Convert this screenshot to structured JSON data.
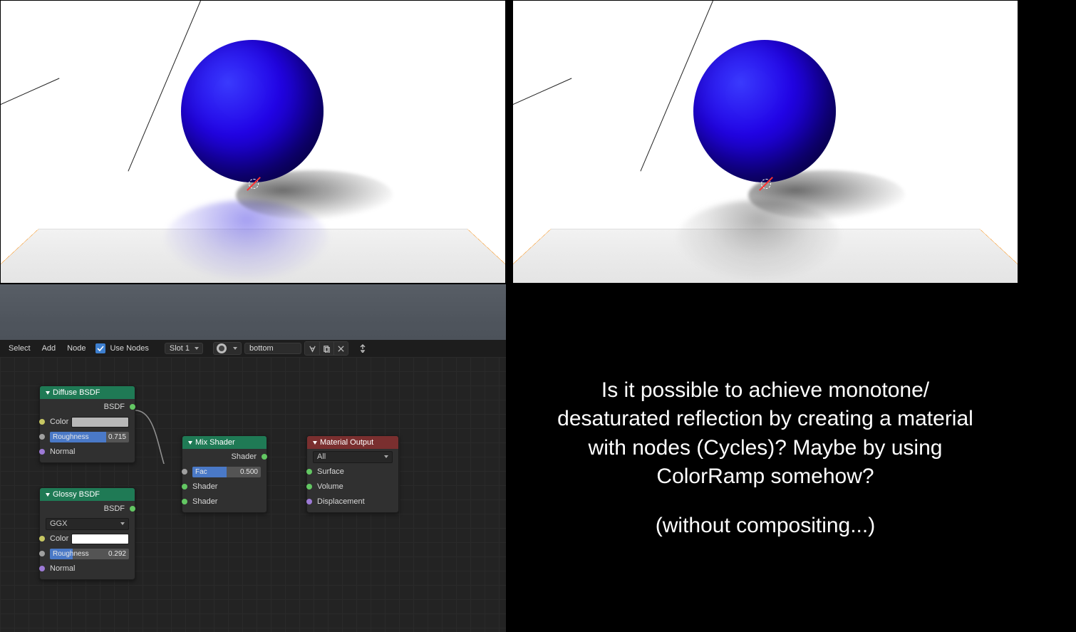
{
  "header": {
    "menu": {
      "select": "Select",
      "add": "Add",
      "node": "Node"
    },
    "use_nodes_label": "Use Nodes",
    "use_nodes_checked": true,
    "slot_label": "Slot 1",
    "material_name": "bottom"
  },
  "nodes": {
    "diffuse": {
      "title": "Diffuse BSDF",
      "out_label": "BSDF",
      "color_label": "Color",
      "color_value": "#b8b8b8",
      "roughness_label": "Roughness",
      "roughness_value": "0.715",
      "roughness_fill_pct": 71.5,
      "normal_label": "Normal"
    },
    "glossy": {
      "title": "Glossy BSDF",
      "out_label": "BSDF",
      "distribution": "GGX",
      "color_label": "Color",
      "color_value": "#ffffff",
      "roughness_label": "Roughness",
      "roughness_value": "0.292",
      "roughness_fill_pct": 29.2,
      "normal_label": "Normal"
    },
    "mix": {
      "title": "Mix Shader",
      "out_label": "Shader",
      "fac_label": "Fac",
      "fac_value": "0.500",
      "fac_fill_pct": 50,
      "shader_in1": "Shader",
      "shader_in2": "Shader"
    },
    "output": {
      "title": "Material Output",
      "target": "All",
      "surface": "Surface",
      "volume": "Volume",
      "displacement": "Displacement"
    }
  },
  "question": {
    "line1": "Is it possible to achieve monotone/ desaturated reflection by creating a material with nodes (Cycles)? Maybe by using ColorRamp somehow?",
    "line2": "(without compositing...)"
  }
}
